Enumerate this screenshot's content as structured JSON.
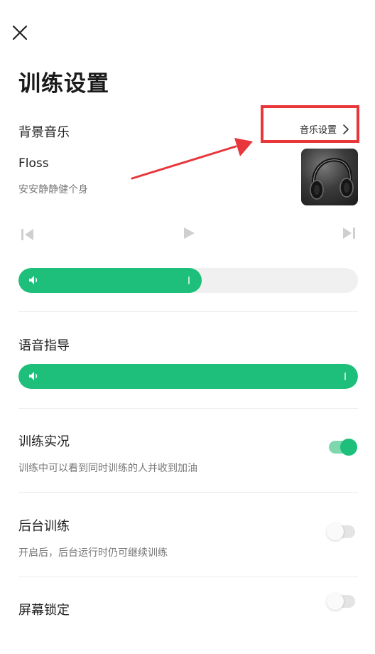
{
  "header": {
    "close_icon": "close-icon",
    "title": "训练设置"
  },
  "music": {
    "section_label": "背景音乐",
    "settings_link": "音乐设置",
    "track_title": "Floss",
    "track_artist": "安安静静健个身",
    "album_art": "headphones-photo",
    "volume_level": 0.54,
    "fill_color": "#1dbf7a"
  },
  "voice": {
    "section_label": "语音指导",
    "volume_level": 1.0
  },
  "live_training": {
    "label": "训练实况",
    "description": "训练中可以看到同时训练的人并收到加油",
    "enabled": true
  },
  "background_training": {
    "label": "后台训练",
    "description": "开启后，后台运行时仍可继续训练",
    "enabled": false
  },
  "screen_lock": {
    "label": "屏幕锁定",
    "enabled": false
  },
  "annotation": {
    "color": "#e8363a"
  }
}
